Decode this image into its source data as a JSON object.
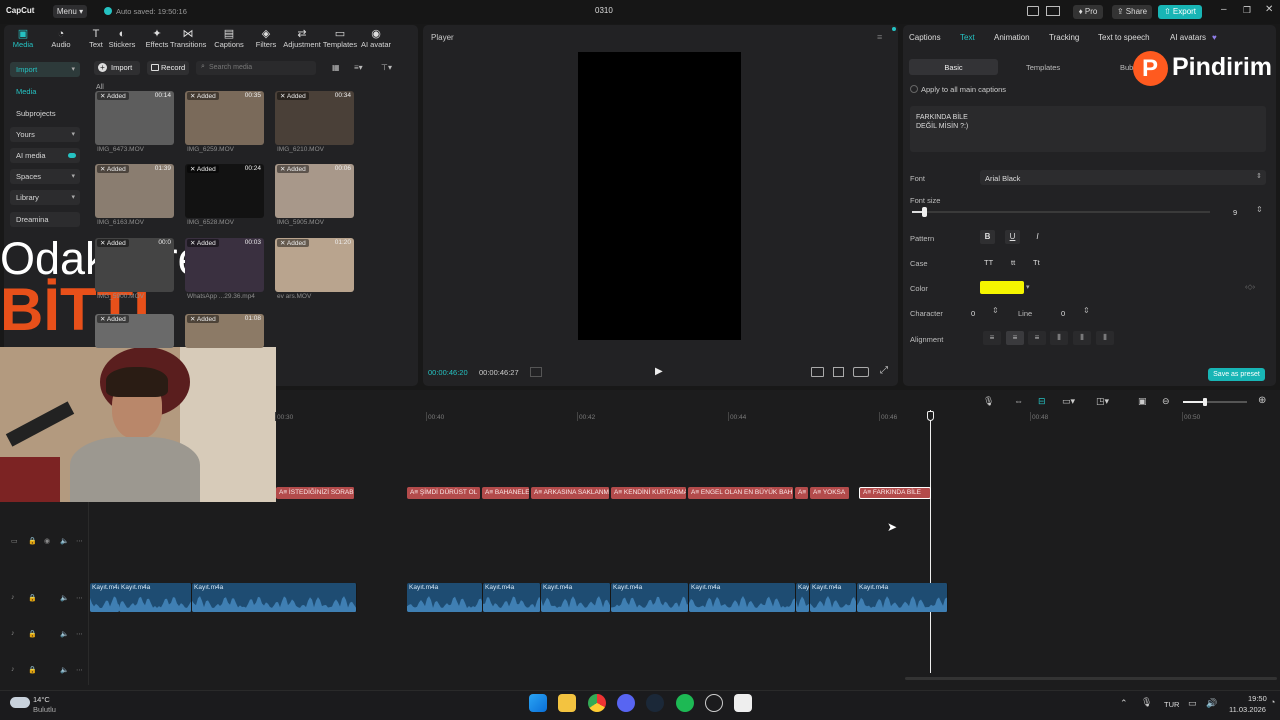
{
  "app": {
    "logo": "CapCut",
    "menu_label": "Menu",
    "autosave": "Auto saved: 19:50:16",
    "project_title": "0310",
    "pro_label": "Pro",
    "share_label": "Share",
    "export_label": "Export"
  },
  "toolbar": {
    "items": [
      "Media",
      "Audio",
      "Text",
      "Stickers",
      "Effects",
      "Transitions",
      "Captions",
      "Filters",
      "Adjustment",
      "Templates",
      "AI avatar"
    ]
  },
  "sidebar": {
    "items": [
      "Import",
      "Media",
      "Subprojects",
      "Yours",
      "AI media",
      "Spaces",
      "Library",
      "Dreamina"
    ]
  },
  "media": {
    "import_label": "Import",
    "record_label": "Record",
    "search_placeholder": "Search media",
    "all_label": "All",
    "added_label": "Added",
    "items": [
      {
        "name": "IMG_6473.MOV",
        "duration": "00:14"
      },
      {
        "name": "IMG_6259.MOV",
        "duration": "00:35"
      },
      {
        "name": "IMG_6210.MOV",
        "duration": "00:34"
      },
      {
        "name": "IMG_6163.MOV",
        "duration": "01:39"
      },
      {
        "name": "IMG_6528.MOV",
        "duration": "00:24"
      },
      {
        "name": "IMG_5905.MOV",
        "duration": "00:06"
      },
      {
        "name": "IMG_5900.MOV",
        "duration": "00:0"
      },
      {
        "name": "WhatsApp ...29.36.mp4",
        "duration": "00:03"
      },
      {
        "name": "ev ars.MOV",
        "duration": "01:20"
      },
      {
        "name": "",
        "duration": ""
      },
      {
        "name": "",
        "duration": "01:08"
      }
    ]
  },
  "overlay": {
    "line1": "OdakSüresi",
    "line2": "BİTTİ",
    "watermark": "Pindirim"
  },
  "player": {
    "title": "Player",
    "current_time": "00:00:46:20",
    "total_time": "00:00:46:27"
  },
  "inspector": {
    "tabs": [
      "Captions",
      "Text",
      "Animation",
      "Tracking",
      "Text to speech",
      "AI avatars"
    ],
    "active_tab": "Text",
    "subtabs": [
      "Basic",
      "Templates",
      "Bub"
    ],
    "apply_all_label": "Apply to all main captions",
    "text_content_line1": "FARKINDA BİLE",
    "text_content_line2": "DEĞİL MİSİN ?:)",
    "font_label": "Font",
    "font_value": "Arial Black",
    "font_size_label": "Font size",
    "font_size_value": "9",
    "pattern_label": "Pattern",
    "pattern_buttons": [
      "B",
      "U",
      "I"
    ],
    "case_label": "Case",
    "case_buttons": [
      "TT",
      "tt",
      "Tt"
    ],
    "color_label": "Color",
    "color_value": "#f5f500",
    "character_label": "Character",
    "character_value": "0",
    "line_label": "Line",
    "line_value": "0",
    "alignment_label": "Alignment",
    "save_preset_label": "Save as preset",
    "font_size_level": 0.04
  },
  "timeline": {
    "ruler": [
      "00:30",
      "00:40",
      "00:42",
      "00:44",
      "00:46",
      "00:48",
      "00:50"
    ],
    "captions": [
      "İSTEDİĞİNİZİ SORABİLİ",
      "ŞİMDİ DÜRÜST OL",
      "BAHANELE",
      "ARKASINA SAKLANM",
      "KENDİNİ KURTARMA",
      "ENGEL OLAN EN BÜYÜK BAH",
      "",
      "YOKSA",
      "FARKINDA BİLE"
    ],
    "audio_clips": [
      "Kayıt.m4a",
      "Kayıt.m4a",
      "Kayıt.m4a",
      "Kayıt.m4a",
      "Kayıt.m4a",
      "Kayıt.m4a",
      "Kayıt.m4a",
      "Kayıt.m4a",
      "Kayı",
      "Kayıt.m4a",
      "Kayıt.m4a"
    ],
    "zoom_level": 0.35
  },
  "taskbar": {
    "weather_temp": "14°C",
    "weather_desc": "Bulutlu",
    "language": "TUR",
    "time": "19:50",
    "date": "11.03.2026"
  },
  "colors": {
    "accent": "#25c2c2",
    "caption_clip": "#b34b4b",
    "audio_clip": "#1e4c72",
    "export": "#18b5b5"
  }
}
